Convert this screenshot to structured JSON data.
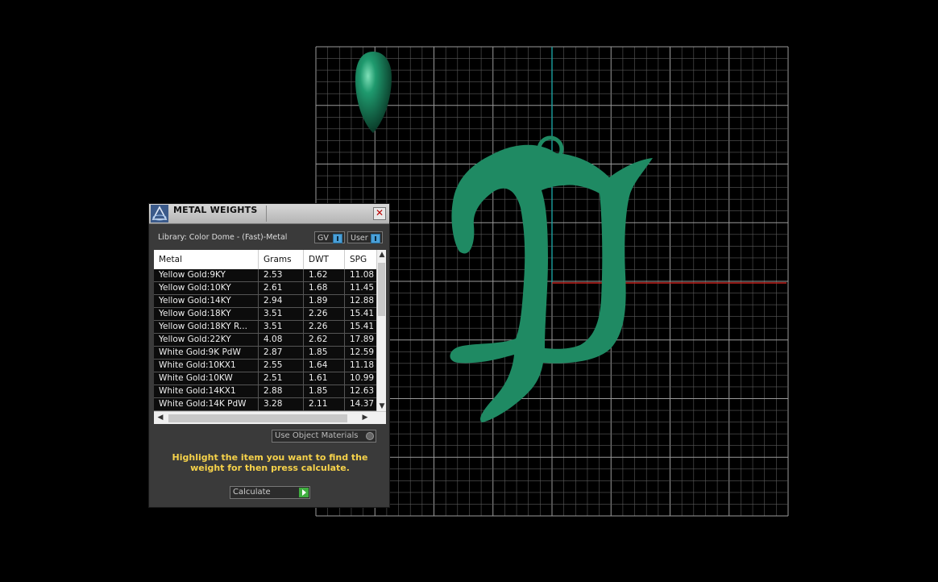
{
  "panel": {
    "title": "METAL WEIGHTS",
    "close_label": "✕",
    "library_label": "Library: Color Dome - (Fast)-Metal",
    "toggle_gv": "GV",
    "toggle_user": "User",
    "columns": [
      "Metal",
      "Grams",
      "DWT",
      "SPG"
    ],
    "rows": [
      [
        "Yellow Gold:9KY",
        "2.53",
        "1.62",
        "11.08"
      ],
      [
        "Yellow Gold:10KY",
        "2.61",
        "1.68",
        "11.45"
      ],
      [
        "Yellow Gold:14KY",
        "2.94",
        "1.89",
        "12.88"
      ],
      [
        "Yellow Gold:18KY",
        "3.51",
        "2.26",
        "15.41"
      ],
      [
        "Yellow Gold:18KY R...",
        "3.51",
        "2.26",
        "15.41"
      ],
      [
        "Yellow Gold:22KY",
        "4.08",
        "2.62",
        "17.89"
      ],
      [
        "White Gold:9K PdW",
        "2.87",
        "1.85",
        "12.59"
      ],
      [
        "White Gold:10KX1",
        "2.55",
        "1.64",
        "11.18"
      ],
      [
        "White Gold:10KW",
        "2.51",
        "1.61",
        "10.99"
      ],
      [
        "White Gold:14KX1",
        "2.88",
        "1.85",
        "12.63"
      ],
      [
        "White Gold:14K PdW",
        "3.28",
        "2.11",
        "14.37"
      ]
    ],
    "use_object_materials": "Use Object Materials",
    "instructions": "Highlight the item you want to find the weight for then press calculate.",
    "calculate_label": "Calculate"
  },
  "colors": {
    "model": "#1f8a63",
    "grid": "#8a8a8a",
    "axis_x": "#c0201a",
    "axis_y": "#1aa0a0",
    "instruction_text": "#f6d24a"
  },
  "icons": {
    "logo": "app-logo-icon",
    "close": "close-icon",
    "calculate_go": "play-icon"
  }
}
